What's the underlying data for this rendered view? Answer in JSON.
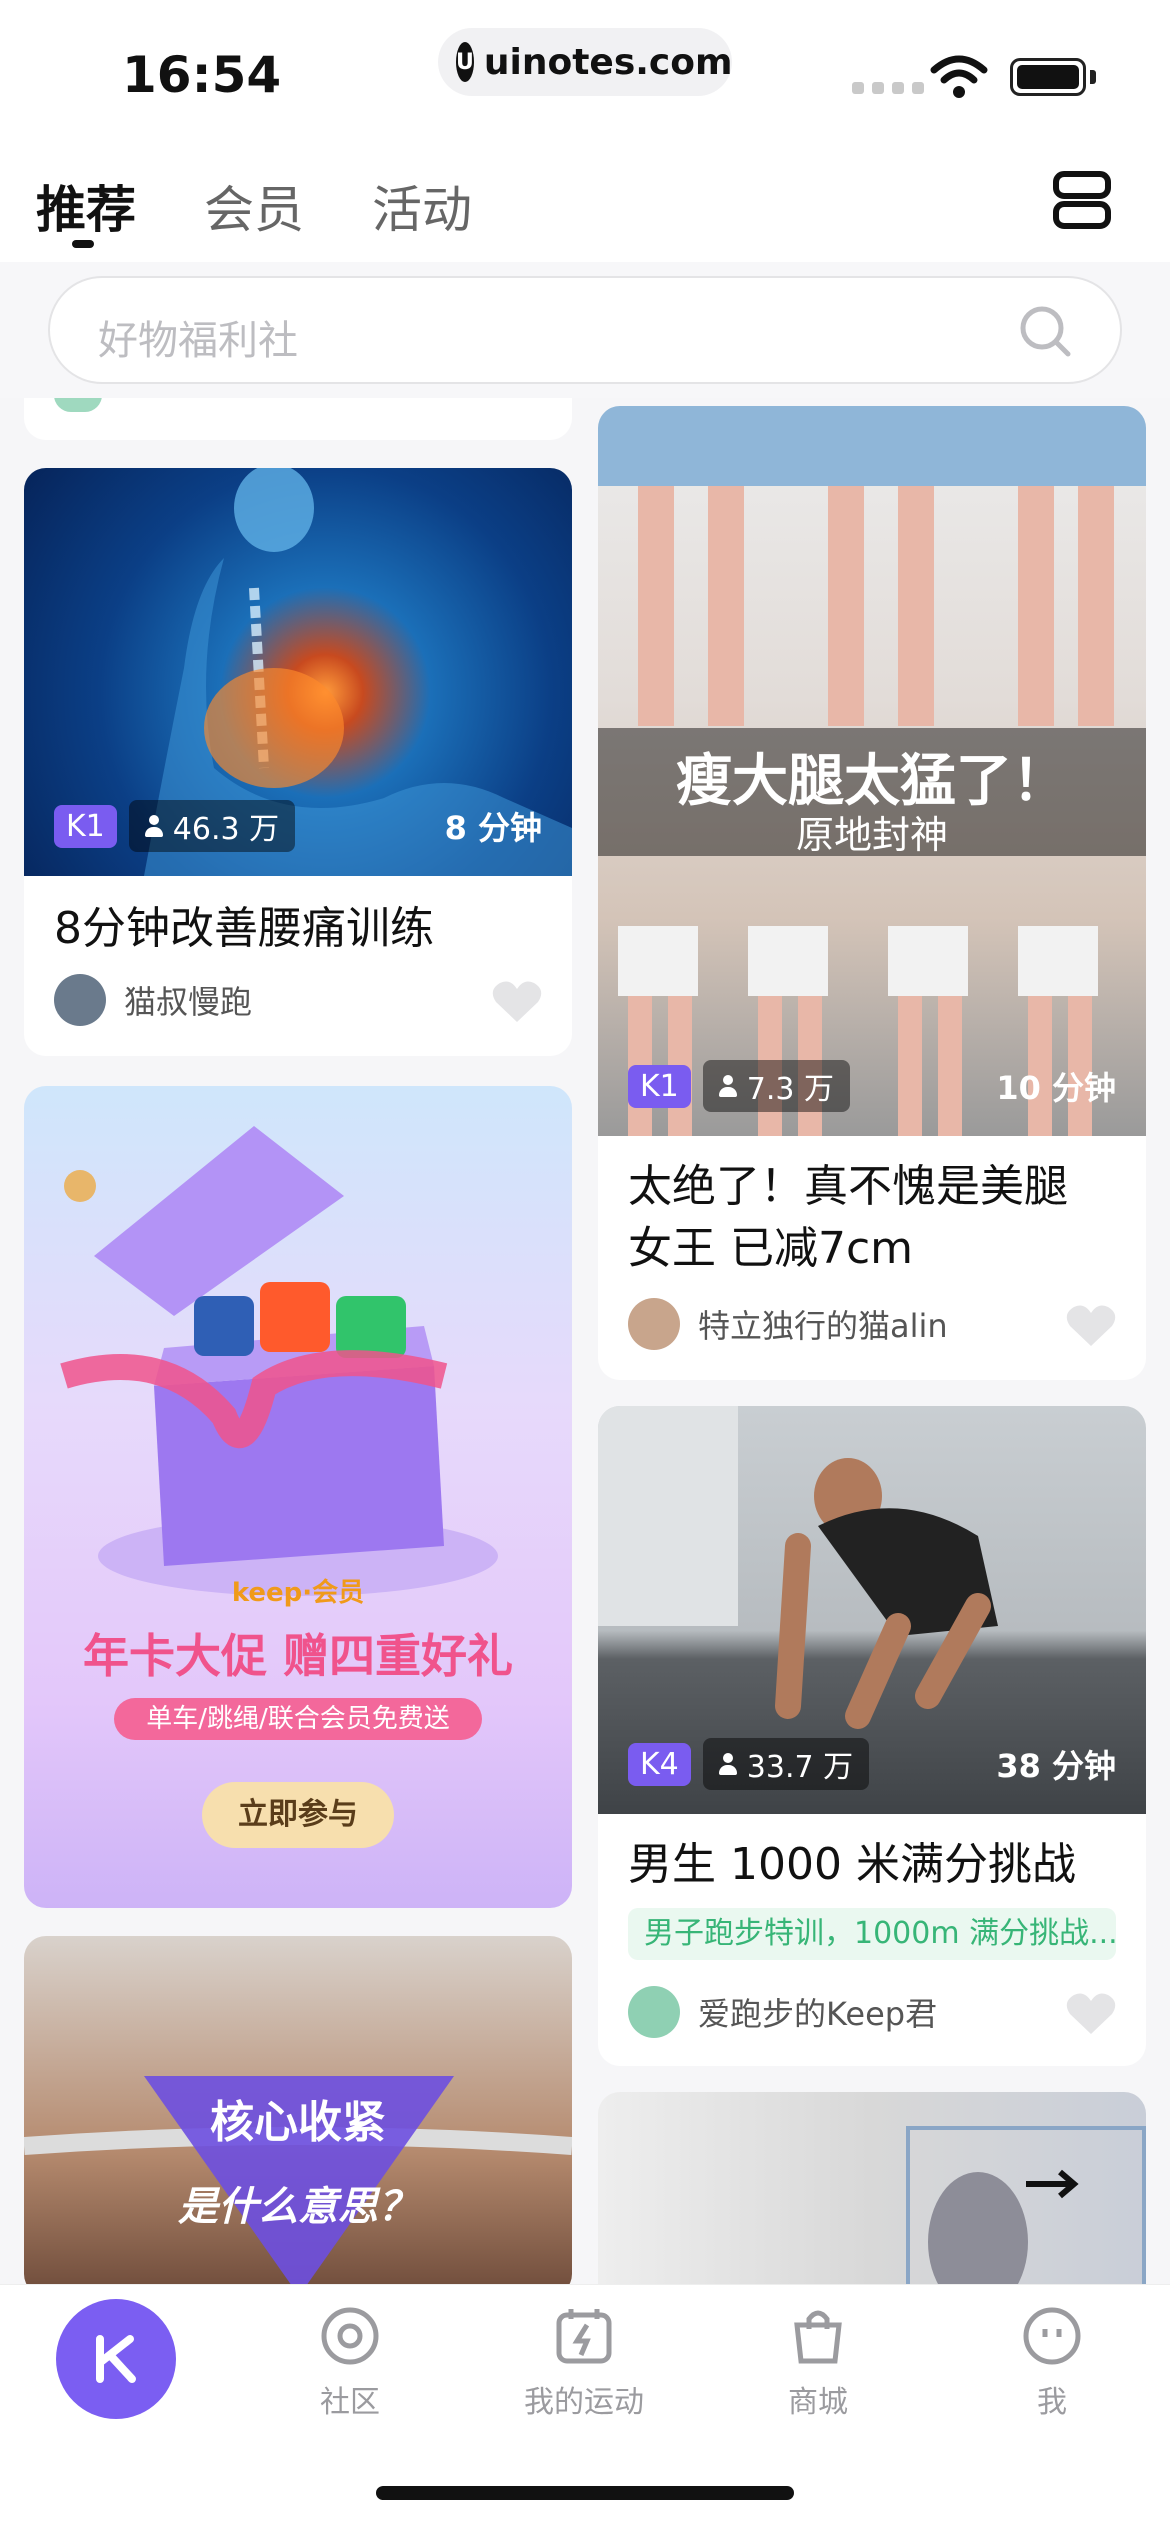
{
  "status_bar": {
    "time": "16:54",
    "url": "uinotes.com"
  },
  "tabs": [
    {
      "label": "推荐",
      "active": true
    },
    {
      "label": "会员",
      "active": false
    },
    {
      "label": "活动",
      "active": false
    }
  ],
  "search": {
    "placeholder": "好物福利社"
  },
  "cards": {
    "c1": {
      "level": "K1",
      "views": "46.3 万",
      "duration": "8 分钟",
      "title": "8分钟改善腰痛训练",
      "author": "猫叔慢跑"
    },
    "c2_banner": {
      "brand": "keep·会员",
      "headline": "年卡大促 赠四重好礼",
      "sub": "单车/跳绳/联合会员免费送",
      "cta": "立即参与"
    },
    "c3": {
      "overlay_line1": "核心收紧",
      "overlay_line2": "是什么意思？"
    },
    "c4": {
      "overlay_big": "瘦大腿太猛了！",
      "overlay_small": "原地封神",
      "level": "K1",
      "views": "7.3 万",
      "duration": "10 分钟",
      "title_line1": "太绝了！真不愧是美腿",
      "title_line2": "女王 已减7cm",
      "author": "特立独行的猫alin"
    },
    "c5": {
      "level": "K4",
      "views": "33.7 万",
      "duration": "38 分钟",
      "title": "男生 1000 米满分挑战",
      "tagline": "男子跑步特训，1000m 满分挑战...",
      "author": "爱跑步的Keep君"
    }
  },
  "bottom_nav": [
    {
      "label": ""
    },
    {
      "label": "社区"
    },
    {
      "label": "我的运动"
    },
    {
      "label": "商城"
    },
    {
      "label": "我"
    }
  ],
  "colors": {
    "accent": "#7b5ef2",
    "tag_green": "#37b577"
  }
}
